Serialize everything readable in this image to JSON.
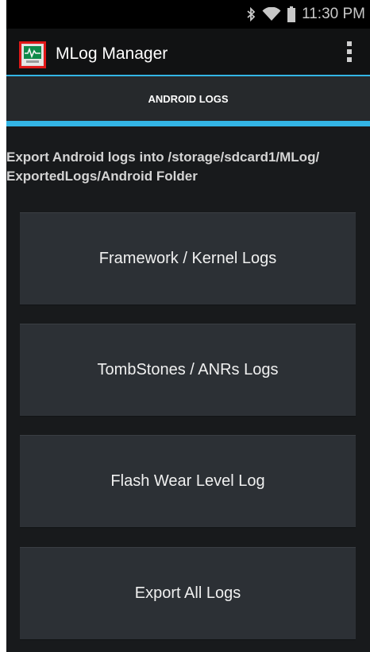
{
  "status_bar": {
    "time": "11:30 PM",
    "icons": [
      "bluetooth-icon",
      "wifi-icon",
      "battery-icon"
    ]
  },
  "action_bar": {
    "title": "MLog Manager",
    "app_icon": "mlog-app-icon",
    "menu_icon": "overflow-menu-icon"
  },
  "tabs": [
    {
      "label": "ANDROID LOGS",
      "selected": true
    }
  ],
  "description": "Export Android logs into /storage/sdcard1/MLog/ ExportedLogs/Android Folder",
  "buttons": [
    {
      "label": "Framework / Kernel Logs"
    },
    {
      "label": "TombStones / ANRs Logs"
    },
    {
      "label": "Flash Wear Level Log"
    },
    {
      "label": "Export All Logs"
    }
  ],
  "colors": {
    "accent": "#33b5e5",
    "background": "#181a1c",
    "button": "#2c3035",
    "app_icon_border": "#e01818"
  }
}
